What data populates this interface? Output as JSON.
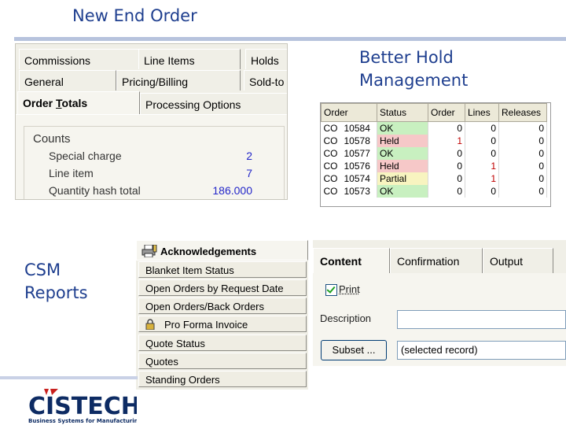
{
  "slide": {
    "title": "New End Order",
    "hold_caption_line1": "Better Hold",
    "hold_caption_line2": "Management",
    "reports_line1": "CSM",
    "reports_line2": "Reports"
  },
  "order_totals": {
    "tabs_row1": [
      "Commissions",
      "Line Items",
      "Holds"
    ],
    "tabs_row2": [
      "General",
      "Pricing/Billing",
      "Sold-to"
    ],
    "tabs_row3": [
      "Order Totals",
      "Processing Options"
    ],
    "counts_title": "Counts",
    "counts": [
      {
        "label": "Special charge",
        "value": "2"
      },
      {
        "label": "Line item",
        "value": "7"
      },
      {
        "label": "Quantity hash total",
        "value": "186.000"
      }
    ]
  },
  "hold_grid": {
    "columns": [
      "Order",
      "Status",
      "Order",
      "Lines",
      "Releases"
    ],
    "rows": [
      {
        "co": "CO",
        "num": "10584",
        "status": "OK",
        "order": "0",
        "lines": "0",
        "releases": "0"
      },
      {
        "co": "CO",
        "num": "10578",
        "status": "Held",
        "order": "1",
        "lines": "0",
        "releases": "0"
      },
      {
        "co": "CO",
        "num": "10577",
        "status": "OK",
        "order": "0",
        "lines": "0",
        "releases": "0"
      },
      {
        "co": "CO",
        "num": "10576",
        "status": "Held",
        "order": "0",
        "lines": "1",
        "releases": "0"
      },
      {
        "co": "CO",
        "num": "10574",
        "status": "Partial",
        "order": "0",
        "lines": "1",
        "releases": "0"
      },
      {
        "co": "CO",
        "num": "10573",
        "status": "OK",
        "order": "0",
        "lines": "0",
        "releases": "0"
      }
    ],
    "status_colors": {
      "OK": "#c8f0c0",
      "Held": "#f6c8c8",
      "Partial": "#f8f4c0"
    }
  },
  "ack_list": {
    "header": "Acknowledgements",
    "items": [
      "Blanket Item Status",
      "Open Orders by Request Date",
      "Open Orders/Back Orders",
      "Pro Forma Invoice",
      "Quote Status",
      "Quotes",
      "Standing Orders"
    ]
  },
  "content_panel": {
    "tabs": [
      "Content",
      "Confirmation",
      "Output"
    ],
    "print_label": "Print",
    "description_label": "Description",
    "description_value": "",
    "subset_button": "Subset ...",
    "subset_value": "(selected record)"
  },
  "logo": {
    "name": "CISTECH",
    "tagline": "Business Systems for Manufacturing"
  },
  "colors": {
    "title_blue": "#1f3f8f",
    "value_blue": "#2326c9",
    "held_red": "#c00000"
  }
}
